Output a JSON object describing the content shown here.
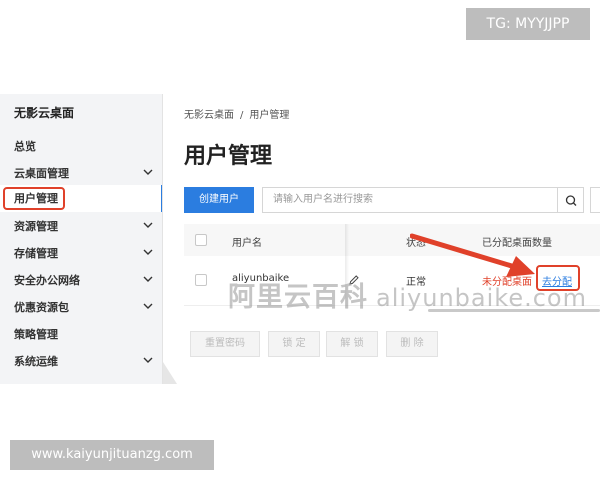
{
  "watermark_top": "TG: MYYJJPP",
  "watermark_bottom": "www.kaiyunjituanzg.com",
  "watermark_center": {
    "cn": "阿里云百科",
    "latin": "aliyunbaike.com"
  },
  "sidebar": {
    "title": "无影云桌面",
    "items": [
      {
        "label": "总览",
        "expandable": false,
        "icon": ""
      },
      {
        "label": "云桌面管理",
        "expandable": true,
        "icon": "chevron-down-icon"
      },
      {
        "label": "用户管理",
        "expandable": false,
        "active": true,
        "icon": ""
      },
      {
        "label": "资源管理",
        "expandable": true,
        "icon": "chevron-down-icon"
      },
      {
        "label": "存储管理",
        "expandable": true,
        "icon": "chevron-down-icon"
      },
      {
        "label": "安全办公网络",
        "expandable": true,
        "icon": "chevron-down-icon"
      },
      {
        "label": "优惠资源包",
        "expandable": true,
        "icon": "chevron-down-icon"
      },
      {
        "label": "策略管理",
        "expandable": false,
        "icon": ""
      },
      {
        "label": "系统运维",
        "expandable": true,
        "icon": "chevron-down-icon"
      }
    ]
  },
  "breadcrumb": [
    "无影云桌面",
    "/",
    "用户管理"
  ],
  "page_title": "用户管理",
  "toolbar": {
    "create_label": "创建用户",
    "search_placeholder": "请输入用户名进行搜索",
    "search_icon": "search-icon"
  },
  "table": {
    "headers": [
      "用户名",
      "状态",
      "已分配桌面数量"
    ],
    "rows": [
      {
        "username": "aliyunbaike",
        "edit_icon": "pencil-icon",
        "status": "正常",
        "assigned": "未分配桌面",
        "assign_link": "去分配"
      }
    ]
  },
  "actions": [
    "重置密码",
    "锁 定",
    "解 锁",
    "删 除"
  ],
  "colors": {
    "accent": "#2b7de0",
    "highlight": "#e0412a",
    "status_red": "#e0412a"
  }
}
